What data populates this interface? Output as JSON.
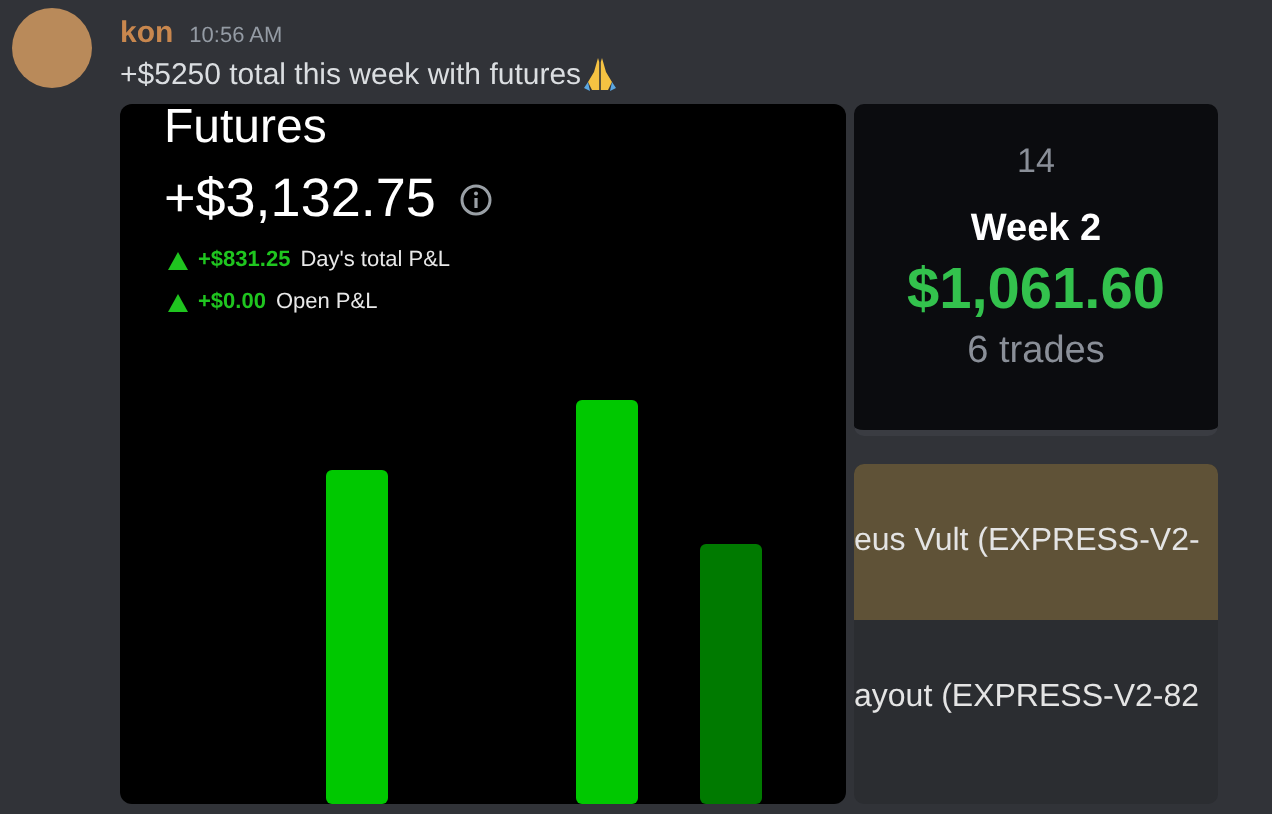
{
  "message": {
    "author": "kon",
    "timestamp": "10:56 AM",
    "text": "+$5250 total this week with futures"
  },
  "futures_card": {
    "title": "Futures",
    "total": "+$3,132.75",
    "stats": [
      {
        "value": "+$831.25",
        "label": "Day's total P&L"
      },
      {
        "value": "+$0.00",
        "label": "Open P&L"
      }
    ]
  },
  "calendar_card": {
    "day": "14",
    "week": "Week 2",
    "amount": "$1,061.60",
    "trades": "6 trades"
  },
  "list_rows": [
    {
      "text": "eus Vult (EXPRESS-V2-",
      "selected": true
    },
    {
      "text": "ayout (EXPRESS-V2-82",
      "selected": false
    }
  ]
}
